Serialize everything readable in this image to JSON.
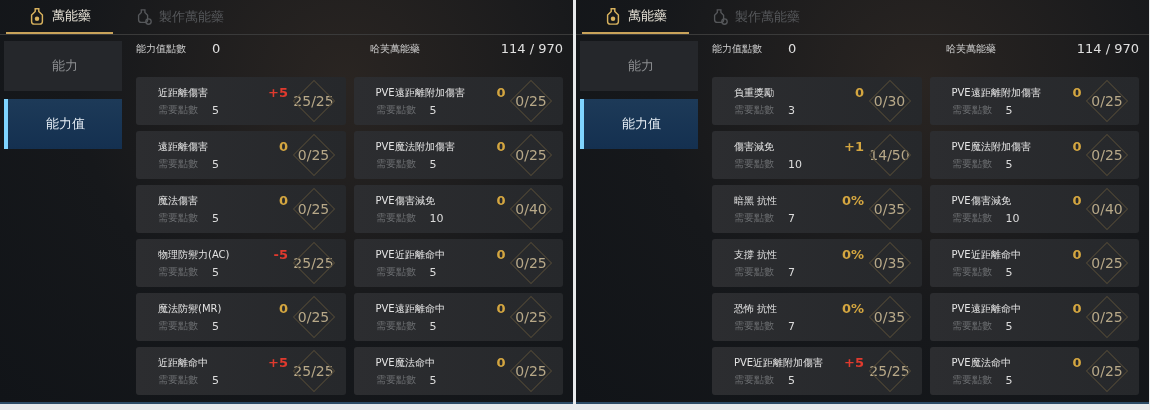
{
  "panels": [
    {
      "tabs": [
        {
          "label": "萬能藥",
          "selected": true
        },
        {
          "label": "製作萬能藥",
          "selected": false
        }
      ],
      "sidebar": {
        "items": [
          {
            "label": "能力",
            "selected": false
          },
          {
            "label": "能力值",
            "selected": true
          }
        ]
      },
      "points": {
        "label": "能力值點數",
        "value": "0"
      },
      "elixir": {
        "label": "哈芙萬能藥",
        "value": "114 / 970"
      },
      "columns": [
        [
          {
            "name": "近距離傷害",
            "bonus": "+5",
            "color": "#e03a2e",
            "cost_label": "需要點數",
            "cost": "5",
            "progress": "25/25"
          },
          {
            "name": "遠距離傷害",
            "bonus": "0",
            "color": "#d4a640",
            "cost_label": "需要點數",
            "cost": "5",
            "progress": "0/25"
          },
          {
            "name": "魔法傷害",
            "bonus": "0",
            "color": "#d4a640",
            "cost_label": "需要點數",
            "cost": "5",
            "progress": "0/25"
          },
          {
            "name": "物理防禦力(AC)",
            "bonus": "-5",
            "color": "#e03a2e",
            "cost_label": "需要點數",
            "cost": "5",
            "progress": "25/25"
          },
          {
            "name": "魔法防禦(MR)",
            "bonus": "0",
            "color": "#d4a640",
            "cost_label": "需要點數",
            "cost": "5",
            "progress": "0/25"
          },
          {
            "name": "近距離命中",
            "bonus": "+5",
            "color": "#e03a2e",
            "cost_label": "需要點數",
            "cost": "5",
            "progress": "25/25"
          }
        ],
        [
          {
            "name": "PVE遠距離附加傷害",
            "bonus": "0",
            "color": "#d4a640",
            "cost_label": "需要點數",
            "cost": "5",
            "progress": "0/25"
          },
          {
            "name": "PVE魔法附加傷害",
            "bonus": "0",
            "color": "#d4a640",
            "cost_label": "需要點數",
            "cost": "5",
            "progress": "0/25"
          },
          {
            "name": "PVE傷害減免",
            "bonus": "0",
            "color": "#d4a640",
            "cost_label": "需要點數",
            "cost": "10",
            "progress": "0/40"
          },
          {
            "name": "PVE近距離命中",
            "bonus": "0",
            "color": "#d4a640",
            "cost_label": "需要點數",
            "cost": "5",
            "progress": "0/25"
          },
          {
            "name": "PVE遠距離命中",
            "bonus": "0",
            "color": "#d4a640",
            "cost_label": "需要點數",
            "cost": "5",
            "progress": "0/25"
          },
          {
            "name": "PVE魔法命中",
            "bonus": "0",
            "color": "#d4a640",
            "cost_label": "需要點數",
            "cost": "5",
            "progress": "0/25"
          }
        ]
      ]
    },
    {
      "tabs": [
        {
          "label": "萬能藥",
          "selected": true
        },
        {
          "label": "製作萬能藥",
          "selected": false
        }
      ],
      "sidebar": {
        "items": [
          {
            "label": "能力",
            "selected": false
          },
          {
            "label": "能力值",
            "selected": true
          }
        ]
      },
      "points": {
        "label": "能力值點數",
        "value": "0"
      },
      "elixir": {
        "label": "哈芙萬能藥",
        "value": "114 / 970"
      },
      "columns": [
        [
          {
            "name": "負重獎勵",
            "bonus": "0",
            "color": "#d4a640",
            "cost_label": "需要點數",
            "cost": "3",
            "progress": "0/30"
          },
          {
            "name": "傷害減免",
            "bonus": "+1",
            "color": "#d4a640",
            "cost_label": "需要點數",
            "cost": "10",
            "progress": "14/50"
          },
          {
            "name": "暗黑 抗性",
            "bonus": "0%",
            "color": "#d4a640",
            "cost_label": "需要點數",
            "cost": "7",
            "progress": "0/35"
          },
          {
            "name": "支撐 抗性",
            "bonus": "0%",
            "color": "#d4a640",
            "cost_label": "需要點數",
            "cost": "7",
            "progress": "0/35"
          },
          {
            "name": "恐怖 抗性",
            "bonus": "0%",
            "color": "#d4a640",
            "cost_label": "需要點數",
            "cost": "7",
            "progress": "0/35"
          },
          {
            "name": "PVE近距離附加傷害",
            "bonus": "+5",
            "color": "#e03a2e",
            "cost_label": "需要點數",
            "cost": "5",
            "progress": "25/25"
          }
        ],
        [
          {
            "name": "PVE遠距離附加傷害",
            "bonus": "0",
            "color": "#d4a640",
            "cost_label": "需要點數",
            "cost": "5",
            "progress": "0/25"
          },
          {
            "name": "PVE魔法附加傷害",
            "bonus": "0",
            "color": "#d4a640",
            "cost_label": "需要點數",
            "cost": "5",
            "progress": "0/25"
          },
          {
            "name": "PVE傷害減免",
            "bonus": "0",
            "color": "#d4a640",
            "cost_label": "需要點數",
            "cost": "10",
            "progress": "0/40"
          },
          {
            "name": "PVE近距離命中",
            "bonus": "0",
            "color": "#d4a640",
            "cost_label": "需要點數",
            "cost": "5",
            "progress": "0/25"
          },
          {
            "name": "PVE遠距離命中",
            "bonus": "0",
            "color": "#d4a640",
            "cost_label": "需要點數",
            "cost": "5",
            "progress": "0/25"
          },
          {
            "name": "PVE魔法命中",
            "bonus": "0",
            "color": "#d4a640",
            "cost_label": "需要點數",
            "cost": "5",
            "progress": "0/25"
          }
        ]
      ]
    }
  ]
}
